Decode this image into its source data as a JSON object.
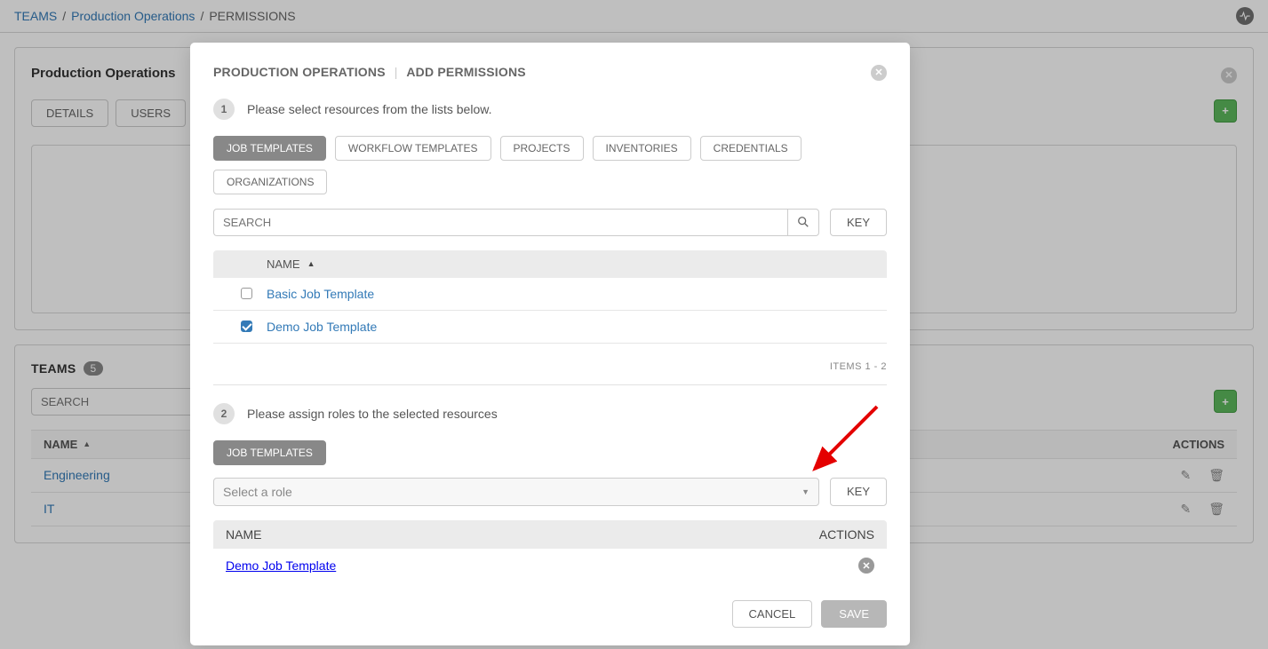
{
  "breadcrumb": {
    "root": "TEAMS",
    "team": "Production Operations",
    "current": "PERMISSIONS"
  },
  "panel": {
    "title": "Production Operations",
    "tabs": {
      "details": "DETAILS",
      "users": "USERS"
    }
  },
  "teams_panel": {
    "title": "TEAMS",
    "count": "5",
    "search_placeholder": "SEARCH",
    "col_name": "NAME",
    "col_actions": "ACTIONS",
    "rows": [
      {
        "name": "Engineering"
      },
      {
        "name": "IT"
      }
    ]
  },
  "modal": {
    "title_a": "PRODUCTION OPERATIONS",
    "title_b": "ADD PERMISSIONS",
    "step1_text": "Please select resources from the lists below.",
    "step2_text": "Please assign roles to the selected resources",
    "pills": {
      "job_templates": "JOB TEMPLATES",
      "workflow_templates": "WORKFLOW TEMPLATES",
      "projects": "PROJECTS",
      "inventories": "INVENTORIES",
      "credentials": "CREDENTIALS",
      "organizations": "ORGANIZATIONS"
    },
    "search_placeholder": "SEARCH",
    "key_label": "KEY",
    "list": {
      "col_name": "NAME",
      "rows": [
        {
          "name": "Basic Job Template",
          "checked": false
        },
        {
          "name": "Demo Job Template",
          "checked": true
        }
      ]
    },
    "items_count": "ITEMS  1 - 2",
    "selected_pill": "JOB TEMPLATES",
    "select_role_placeholder": "Select a role",
    "selected_table": {
      "col_name": "NAME",
      "col_actions": "ACTIONS",
      "rows": [
        {
          "name": "Demo Job Template"
        }
      ]
    },
    "cancel": "CANCEL",
    "save": "SAVE"
  }
}
